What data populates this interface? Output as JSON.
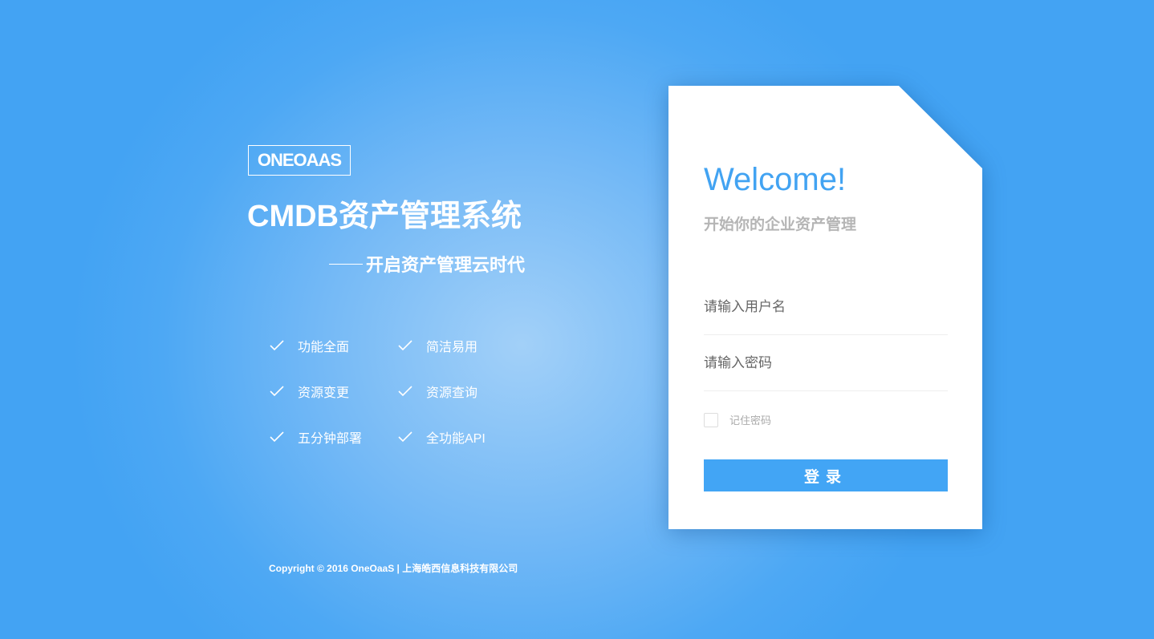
{
  "brand": {
    "logo": "ONEOAAS",
    "title": "CMDB资产管理系统",
    "slogan": "开启资产管理云时代"
  },
  "features": [
    "功能全面",
    "简洁易用",
    "资源变更",
    "资源查询",
    "五分钟部署",
    "全功能API"
  ],
  "footer": {
    "copyright": "Copyright © 2016 OneOaaS | 上海皓西信息科技有限公司"
  },
  "login": {
    "welcome": "Welcome!",
    "subtitle": "开始你的企业资产管理",
    "username_placeholder": "请输入用户名",
    "password_placeholder": "请输入密码",
    "remember_label": "记住密码",
    "submit_label": "登录"
  },
  "colors": {
    "accent": "#42a5f5",
    "background": "#43a3f3"
  }
}
